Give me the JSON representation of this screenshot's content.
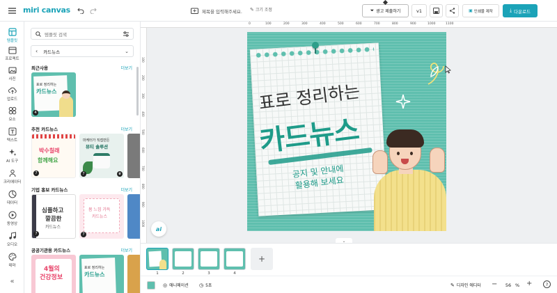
{
  "brand": {
    "logo": "miri canvas",
    "color": "#1ba3b8"
  },
  "topbar": {
    "doc_title_placeholder": "제목을 입력해주세요.",
    "resize_label": "크기 조정",
    "ad_submit_label": "광고 제출하기",
    "version_label": "v1",
    "print_label": "인쇄물 제작",
    "download_label": "다운로드"
  },
  "rail": [
    {
      "label": "템플릿",
      "icon": "template-icon"
    },
    {
      "label": "프로젝트",
      "icon": "project-icon"
    },
    {
      "label": "사진",
      "icon": "photo-icon"
    },
    {
      "label": "업로드",
      "icon": "upload-icon"
    },
    {
      "label": "요소",
      "icon": "elements-icon"
    },
    {
      "label": "텍스트",
      "icon": "text-icon"
    },
    {
      "label": "AI 도구",
      "icon": "ai-tools-icon"
    },
    {
      "label": "크리에이터",
      "icon": "creator-icon"
    },
    {
      "label": "데이터",
      "icon": "data-icon"
    },
    {
      "label": "동영상",
      "icon": "video-icon"
    },
    {
      "label": "오디오",
      "icon": "audio-icon"
    },
    {
      "label": "테마",
      "icon": "theme-icon"
    }
  ],
  "panel": {
    "search_placeholder": "템플릿 검색",
    "category": "카드뉴스",
    "more_label": "더보기",
    "sections": [
      {
        "title": "최근사용"
      },
      {
        "title": "추천 카드뉴스"
      },
      {
        "title": "기업 홍보 카드뉴스"
      },
      {
        "title": "공공기관용 카드뉴스"
      }
    ],
    "recent_thumb": {
      "line1": "표로 정리하는",
      "line2": "카드뉴스",
      "badge": "4"
    },
    "rec_thumbs": [
      {
        "line1": "박수칠래",
        "line2": "함께해요",
        "badge": "7"
      },
      {
        "line1": "마케터가 직접만든",
        "line2": "뷰티 솔루션",
        "badge": "7"
      }
    ],
    "corp_thumbs": [
      {
        "line1": "심플하고",
        "line2": "깔끔한",
        "line3": "카드뉴스",
        "badge": "7"
      },
      {
        "line1": "봄 느낌 가득",
        "line2": "카드뉴스",
        "badge": "7"
      }
    ],
    "public_thumbs": [
      {
        "line1": "4월의",
        "line2": "건강정보"
      },
      {
        "line1": "표로 정리하는",
        "line2": "카드뉴스"
      }
    ]
  },
  "ruler": {
    "ticks": [
      "0",
      "100",
      "200",
      "300",
      "400",
      "500",
      "600",
      "700",
      "800",
      "900",
      "1000",
      "1100"
    ],
    "vticks": [
      "100",
      "200",
      "300",
      "400",
      "500",
      "600",
      "700",
      "800",
      "900",
      "1000"
    ]
  },
  "canvas": {
    "title_line1": "표로 정리하는",
    "title_line2": "카드뉴스",
    "subtitle_line1": "공지 및 안내에",
    "subtitle_line2": "활용해 보세요",
    "bg_color": "#5fbfae",
    "paper_color": "#f7f9f8",
    "accent": "#1e9b89"
  },
  "ai_button": "ai",
  "pages": [
    {
      "num": "1"
    },
    {
      "num": "2"
    },
    {
      "num": "3"
    },
    {
      "num": "4"
    }
  ],
  "bottombar": {
    "animation_label": "애니메이션",
    "duration_label": "5초",
    "design_editor_label": "디자인 에디터",
    "zoom_value": "56",
    "zoom_unit": "%"
  }
}
